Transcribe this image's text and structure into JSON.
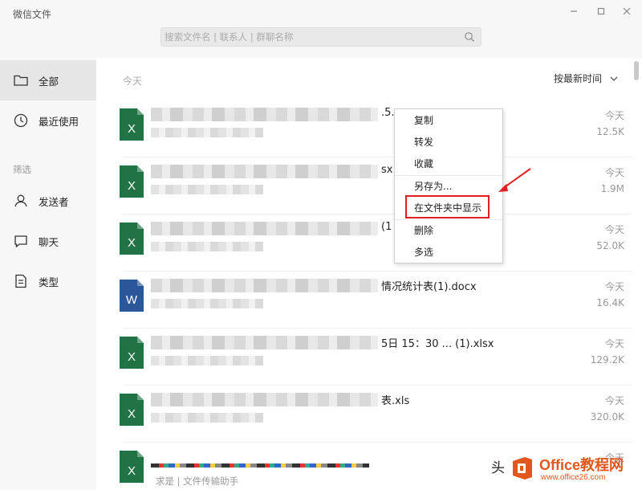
{
  "window": {
    "title": "微信文件",
    "controls": [
      "minimize-icon",
      "maximize-icon",
      "close-icon"
    ]
  },
  "search": {
    "placeholder": "搜索文件名 | 联系人 | 群聊名称",
    "value": "",
    "icon": "search-icon"
  },
  "sidebar": {
    "items": [
      {
        "label": "全部",
        "icon": "folder-icon",
        "active": true
      },
      {
        "label": "最近使用",
        "icon": "clock-icon",
        "active": false
      }
    ],
    "filter_section": "筛选",
    "filters": [
      {
        "label": "发送者",
        "icon": "person-icon"
      },
      {
        "label": "聊天",
        "icon": "chat-icon"
      },
      {
        "label": "类型",
        "icon": "document-icon"
      }
    ]
  },
  "main": {
    "group_label": "今天",
    "sort_label": "按最新时间",
    "files": [
      {
        "type": "excel",
        "name_tail": ".5.",
        "date": "今天",
        "size": "12.5K"
      },
      {
        "type": "excel",
        "name_tail": "sx",
        "date": "今天",
        "size": "1.9M"
      },
      {
        "type": "excel",
        "name_tail": "(1",
        "date": "今天",
        "size": "52.0K"
      },
      {
        "type": "word",
        "name_tail": "情况统计表(1).docx",
        "date": "今天",
        "size": "16.4K"
      },
      {
        "type": "excel",
        "name_tail": "5日 15：30 ... (1).xlsx",
        "date": "今天",
        "size": "129.2K"
      },
      {
        "type": "excel",
        "name_tail": "表.xls",
        "date": "今天",
        "size": "320.0K"
      },
      {
        "type": "excel",
        "name_tail": "",
        "date": "今天",
        "size": "",
        "sender": "求是 | 文件传输助手"
      }
    ]
  },
  "context_menu": {
    "items": [
      "复制",
      "转发",
      "收藏",
      "另存为...",
      "在文件夹中显示",
      "删除",
      "多选"
    ],
    "highlighted": "在文件夹中显示"
  },
  "watermark": {
    "text": "头",
    "brand": "Office教程网",
    "url": "www.office26.com"
  },
  "colors": {
    "excel": "#217346",
    "word": "#2b579a",
    "highlight": "#e02020",
    "brand": "#e2571e"
  }
}
